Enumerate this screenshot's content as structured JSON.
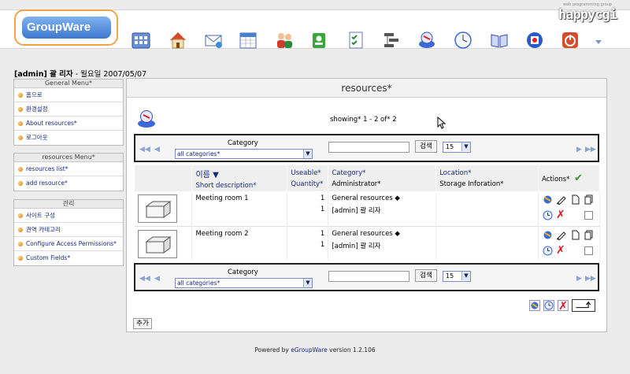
{
  "header": {
    "logo_text": "GroupWare",
    "brand_small": "web programming group",
    "brand_text": "happycgi",
    "accent": "#3f78cf"
  },
  "toolbar": {
    "icons": [
      "calendar-grid-icon",
      "home-icon",
      "email-icon",
      "calendar-icon",
      "people-icon",
      "addressbook-icon",
      "todo-icon",
      "network-icon",
      "resources-icon",
      "clock-icon",
      "book-icon",
      "admin-icon",
      "power-icon",
      "scroll-down-icon"
    ]
  },
  "user": {
    "name": "[admin] 괄 리자",
    "date": " - 월요일 2007/05/07"
  },
  "sidebar": {
    "general": {
      "title": "General Menu*",
      "items": [
        "홈으로",
        "환경설정",
        "About resources*",
        "로그아웃"
      ]
    },
    "resources": {
      "title": "resources Menu*",
      "items": [
        "resources list*",
        "add resource*"
      ]
    },
    "admin": {
      "title": "관리",
      "items": [
        "사이트 구성",
        "권역 카테고리",
        "Configure Access Permissions*",
        "Custom Fields*"
      ]
    }
  },
  "main": {
    "title": "resources*",
    "showing": "showing* 1 - 2 of* 2",
    "nav": {
      "category_label": "Category",
      "category_value": "all categories*",
      "search_value": "",
      "search_button": "검색",
      "per_page": "15"
    },
    "table": {
      "col_name": "이름",
      "col_desc": "Short description*",
      "col_useable": "Useable*",
      "col_quantity": "Quantity*",
      "col_category": "Category*",
      "col_admin": "Administrator*",
      "col_location": "Location*",
      "col_storage": "Storage Inforation*",
      "col_actions": "Actions*",
      "rows": [
        {
          "name": "Meeting room 1",
          "useable": "1",
          "quantity": "1",
          "category": "General resources ◆",
          "admin": "[admin] 괄 리자",
          "location": ""
        },
        {
          "name": "Meeting room 2",
          "useable": "1",
          "quantity": "1",
          "category": "General resources ◆",
          "admin": "[admin] 괄 리자",
          "location": ""
        }
      ]
    },
    "add_button": "추가"
  },
  "footer": {
    "prefix": "Powered by ",
    "link": "eGroupWare",
    "suffix": " version 1.2.106"
  }
}
